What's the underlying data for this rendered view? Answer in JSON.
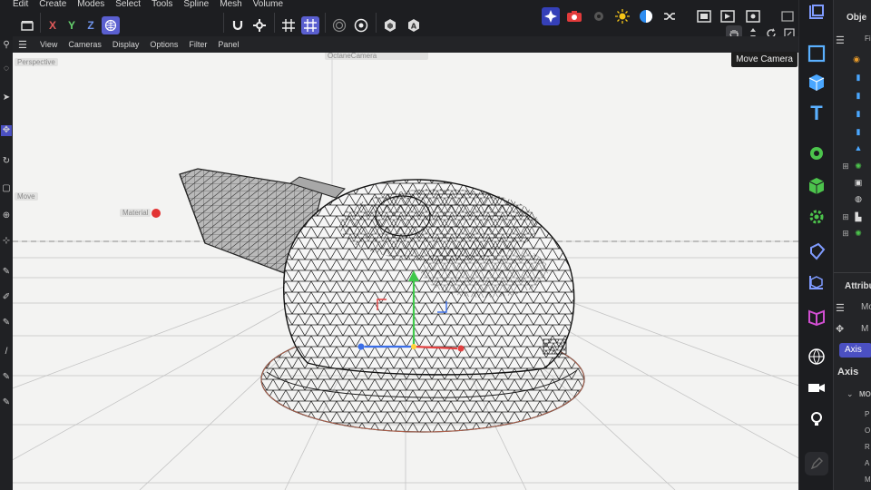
{
  "menubar": {
    "items": [
      "Edit",
      "Create",
      "Modes",
      "Select",
      "Tools",
      "Spline",
      "Mesh",
      "Volume"
    ]
  },
  "toolbar": {
    "axis_x": "X",
    "axis_y": "Y",
    "axis_z": "Z"
  },
  "viewport_menu": {
    "items": [
      "View",
      "Cameras",
      "Display",
      "Options",
      "Filter",
      "Panel"
    ]
  },
  "viewport": {
    "camera_label": "Perspective",
    "octane_camera_label": "OctaneCamera",
    "move_label": "Move",
    "material_label": "Material"
  },
  "tooltip": {
    "text": "Move Camera"
  },
  "right_panel": {
    "objects_title": "Obje",
    "objects_sub": "Fi",
    "attributes_title": "Attribu",
    "mode_label": "Mo",
    "model_label": "M",
    "axis_tab": "Axis",
    "axis_heading": "Axis",
    "section_label": "MO",
    "rows": [
      "P",
      "O",
      "R",
      "A",
      "M"
    ]
  },
  "colors": {
    "accent": "#5a5fd0",
    "viewport_bg": "#f3f3f2",
    "panel_bg": "#242528",
    "axis_x": "#e24040",
    "axis_y": "#3fc84a",
    "axis_z": "#3a6ee8"
  }
}
